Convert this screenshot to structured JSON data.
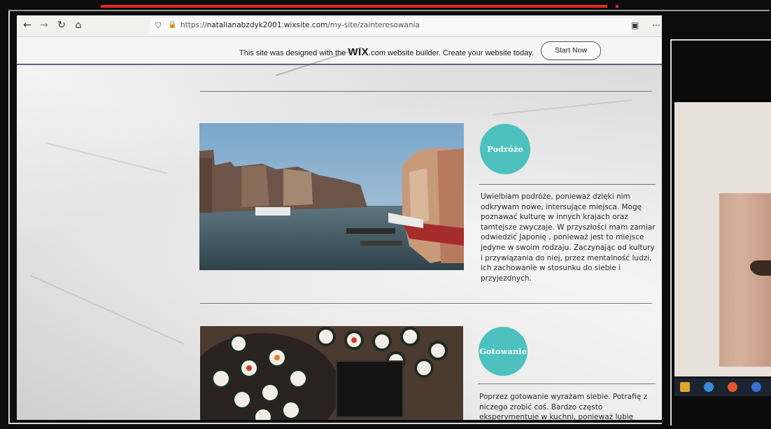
{
  "browser": {
    "url_prefix": "https://",
    "url_host": "natalianabzdyk2001.wixsite.com",
    "url_path": "/my-site/zainteresowania",
    "nav_icons": [
      "back-icon",
      "forward-icon",
      "reload-icon",
      "home-icon"
    ],
    "toolbar_icons": [
      "reader-icon",
      "more-icon",
      "pocket-icon",
      "bookmark-icon"
    ]
  },
  "wix_banner": {
    "text_before": "This site was designed with the ",
    "logo": "WIX",
    "logo_suffix": ".com",
    "text_after": " website builder. Create your website today.",
    "button_label": "Start Now"
  },
  "sections": [
    {
      "title": "Podróże",
      "text": "Uwielbiam podróże, ponieważ dzięki nim odkrywam nowe, intersujące miejsca. Mogę poznawać kulturę w innych krajach oraz tamtejsze zwyczaje. W przyszłości mam zamiar odwiedzić Japonię , ponieważ jest to miejsce jedyne w swoim rodzaju. Zaczynając od kultury i przywiązania do niej, przez mentalność ludzi, ich zachowanie w stosunku do siebie i przyjezdnych."
    },
    {
      "title": "Gotowanie",
      "text": "Poprzez gotowanie wyrażam siebie. Potrafię z niczego zrobić coś. Bardzo często eksperymentuje w kuchni, ponieważ lubię"
    }
  ],
  "colors": {
    "accent_circle": "#4cc1bd",
    "wix_border": "#6d5a84",
    "progress": "#e32b23"
  }
}
